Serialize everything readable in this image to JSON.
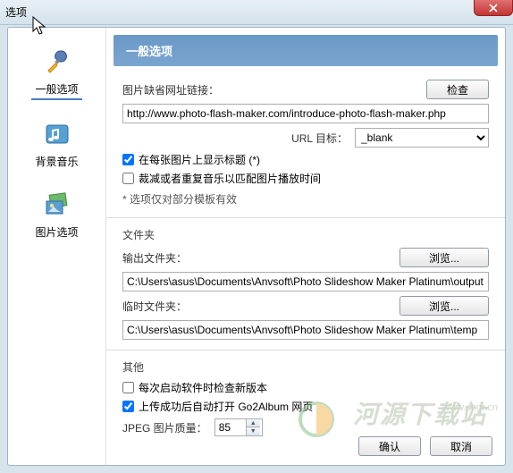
{
  "title": "选项",
  "sidebar": {
    "items": [
      {
        "label": "一般选项"
      },
      {
        "label": "背景音乐"
      },
      {
        "label": "图片选项"
      }
    ]
  },
  "header": "一般选项",
  "general": {
    "label_default_url": "图片缺省网址链接：",
    "btn_check": "检查",
    "url_value": "http://www.photo-flash-maker.com/introduce-photo-flash-maker.php",
    "label_url_target": "URL 目标：",
    "target_value": "_blank",
    "chk_show_title": "在每张图片上显示标题 (*)",
    "chk_trim_music": "裁减或者重复音乐以匹配图片播放时间",
    "note": "* 选项仅对部分模板有效"
  },
  "folders": {
    "title": "文件夹",
    "label_output": "输出文件夹：",
    "output_value": "C:\\Users\\asus\\Documents\\Anvsoft\\Photo Slideshow Maker Platinum\\output",
    "label_temp": "临时文件夹：",
    "temp_value": "C:\\Users\\asus\\Documents\\Anvsoft\\Photo Slideshow Maker Platinum\\temp",
    "btn_browse": "浏览..."
  },
  "other": {
    "title": "其他",
    "chk_check_update": "每次启动软件时检查新版本",
    "chk_open_go2album": "上传成功后自动打开 Go2Album 网页",
    "label_jpeg": "JPEG 图片质量：",
    "jpeg_value": "85"
  },
  "buttons": {
    "ok": "确认",
    "cancel": "取消"
  },
  "watermark": "河源下载站",
  "watermark_url": "www.chgr.cn"
}
